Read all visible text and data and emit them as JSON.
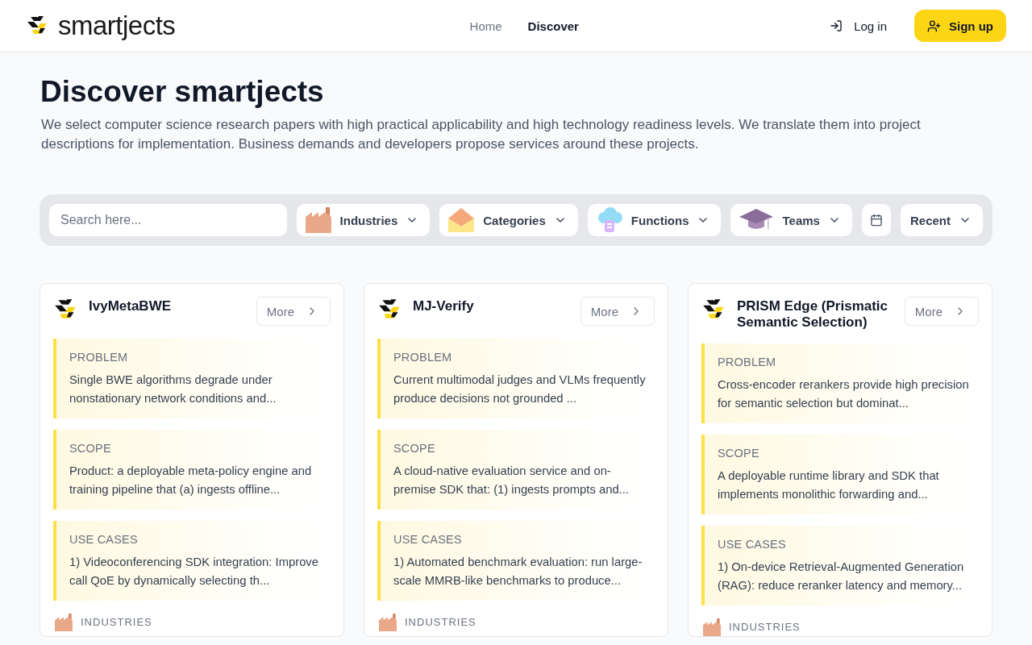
{
  "brand": "smartjects",
  "nav": [
    {
      "label": "Home",
      "selected": false
    },
    {
      "label": "Discover",
      "selected": true
    }
  ],
  "auth": {
    "login": "Log in",
    "signup": "Sign up"
  },
  "hero": {
    "title": "Discover smartjects",
    "description": "We select computer science research papers with high practical applicability and high technology readiness levels. We translate them into project descriptions for implementation. Business demands and developers propose services around these projects."
  },
  "filters": {
    "search_placeholder": "Search here...",
    "dropdowns": [
      {
        "label": "Industries"
      },
      {
        "label": "Categories"
      },
      {
        "label": "Functions"
      },
      {
        "label": "Teams"
      }
    ],
    "sort": "Recent"
  },
  "cards": [
    {
      "title": "IvyMetaBWE",
      "more": "More",
      "sections": [
        {
          "label": "PROBLEM",
          "text": "Single BWE algorithms degrade under nonstationary network conditions and..."
        },
        {
          "label": "SCOPE",
          "text": "Product: a deployable meta-policy engine and training pipeline that (a) ingests offline..."
        },
        {
          "label": "USE CASES",
          "text": "1) Videoconferencing SDK integration: Improve call QoE by dynamically selecting th..."
        }
      ],
      "footer_label": "INDUSTRIES"
    },
    {
      "title": "MJ-Verify",
      "more": "More",
      "sections": [
        {
          "label": "PROBLEM",
          "text": "Current multimodal judges and VLMs frequently produce decisions not grounded ..."
        },
        {
          "label": "SCOPE",
          "text": "A cloud-native evaluation service and on-premise SDK that: (1) ingests prompts and..."
        },
        {
          "label": "USE CASES",
          "text": "1) Automated benchmark evaluation: run large-scale MMRB-like benchmarks to produce..."
        }
      ],
      "footer_label": "INDUSTRIES"
    },
    {
      "title": "PRISM Edge (Prismatic Semantic Selection)",
      "more": "More",
      "sections": [
        {
          "label": "PROBLEM",
          "text": "Cross-encoder rerankers provide high precision for semantic selection but dominat..."
        },
        {
          "label": "SCOPE",
          "text": "A deployable runtime library and SDK that implements monolithic forwarding and..."
        },
        {
          "label": "USE CASES",
          "text": "1) On-device Retrieval-Augmented Generation (RAG): reduce reranker latency and memory..."
        }
      ],
      "footer_label": "INDUSTRIES"
    }
  ]
}
